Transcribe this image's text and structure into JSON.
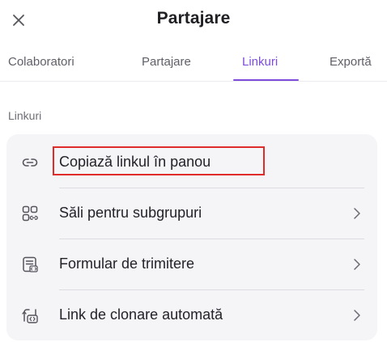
{
  "dialog": {
    "title": "Partajare",
    "close_icon": "close-icon"
  },
  "tabs": [
    {
      "label": "Colaboratori",
      "active": false
    },
    {
      "label": "Partajare",
      "active": false
    },
    {
      "label": "Linkuri",
      "active": true
    },
    {
      "label": "Exportă",
      "active": false
    }
  ],
  "section": {
    "label": "Linkuri"
  },
  "items": [
    {
      "label": "Copiază linkul în panou",
      "icon": "link-icon",
      "has_chevron": false,
      "highlighted": true
    },
    {
      "label": "Săli pentru subgrupuri",
      "icon": "subgroup-rooms-icon",
      "has_chevron": true,
      "highlighted": false
    },
    {
      "label": "Formular de trimitere",
      "icon": "submission-form-icon",
      "has_chevron": true,
      "highlighted": false
    },
    {
      "label": "Link de clonare automată",
      "icon": "auto-clone-link-icon",
      "has_chevron": true,
      "highlighted": false
    }
  ],
  "colors": {
    "accent": "#7d4cdb",
    "highlight_border": "#e02b2b",
    "card_background": "#f5f5f7"
  }
}
